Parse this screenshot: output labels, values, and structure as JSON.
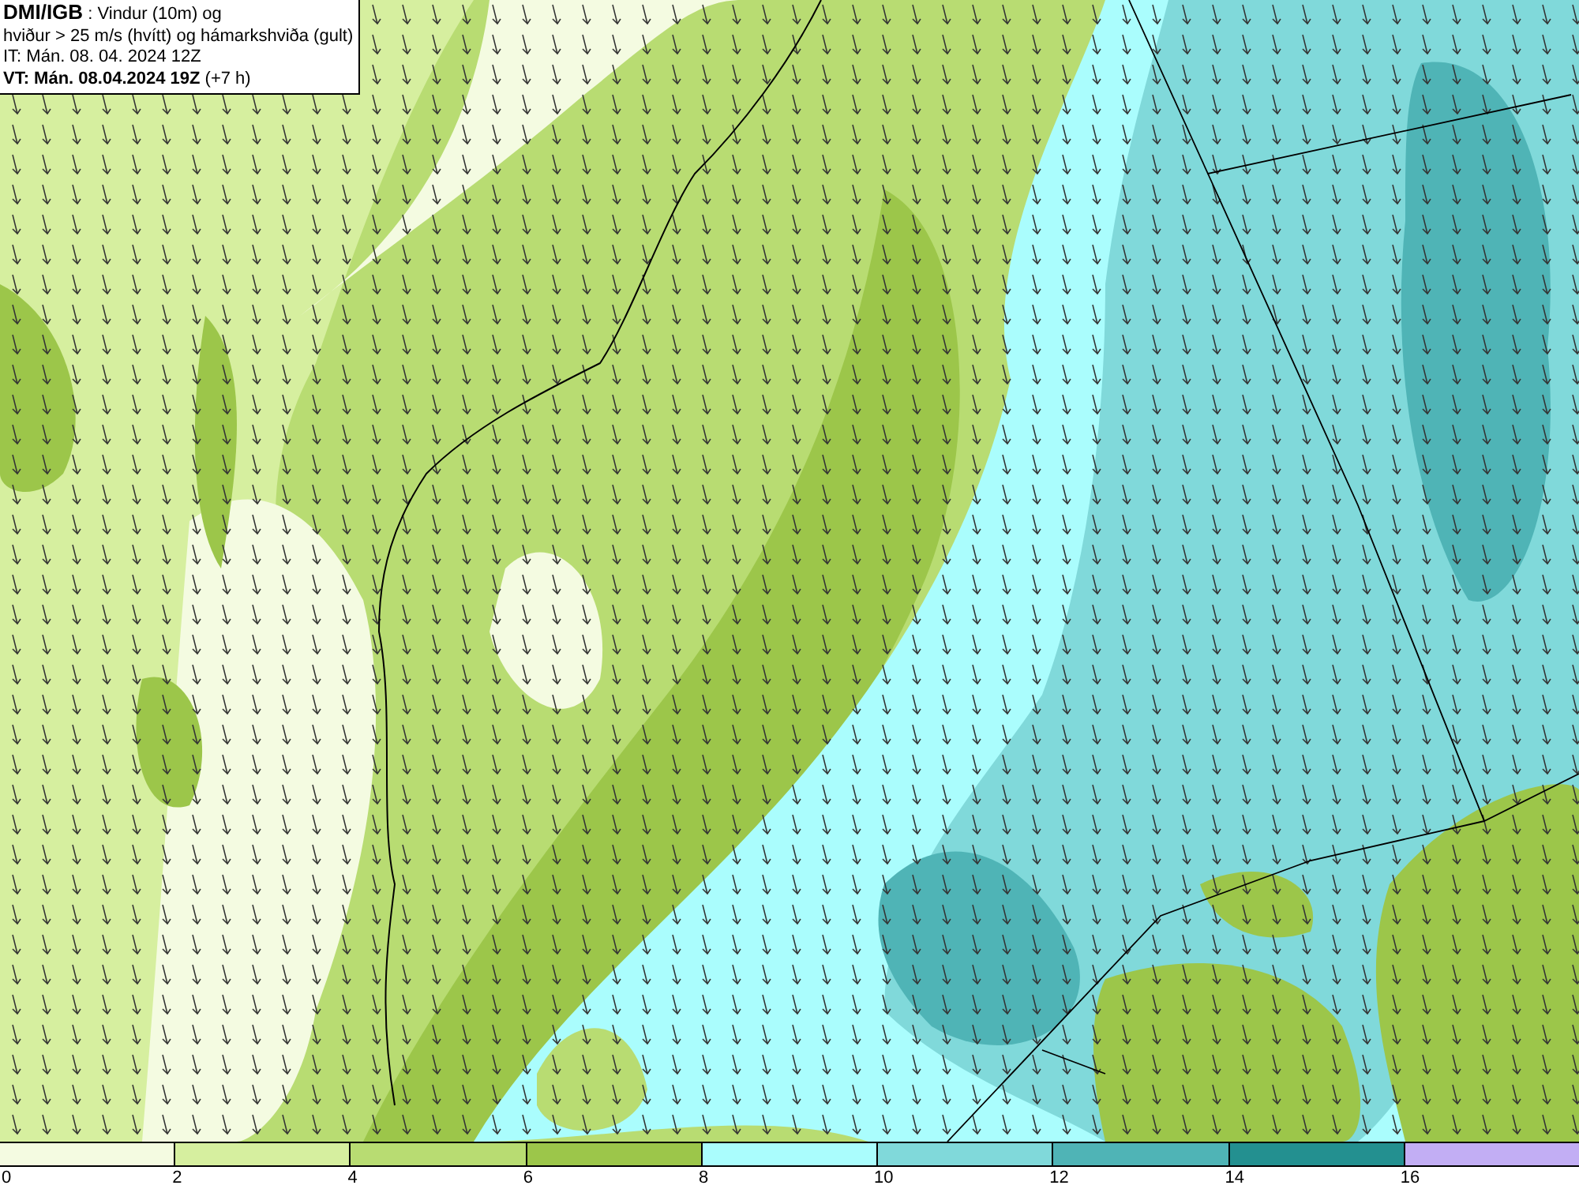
{
  "info_box": {
    "source": "DMI/IGB",
    "title_rest": " : Vindur (10m) og",
    "subtitle": "hviður > 25 m/s (hvítt) og hámarkshviða (gult)",
    "initial_time": "IT: Mán. 08. 04. 2024 12Z",
    "valid_time": "VT: Mán. 08.04.2024 19Z",
    "lead_time": "(+7 h)"
  },
  "legend": {
    "bins": [
      {
        "color": "#f4fbe1"
      },
      {
        "color": "#d6ef9f"
      },
      {
        "color": "#b8dc72"
      },
      {
        "color": "#9cc64a"
      },
      {
        "color": "#aafdfd"
      },
      {
        "color": "#80d9da"
      },
      {
        "color": "#4fb4b6"
      },
      {
        "color": "#239090"
      },
      {
        "color": "#c2aef4"
      }
    ],
    "ticks": [
      "0",
      "2",
      "4",
      "6",
      "8",
      "10",
      "12",
      "14",
      "16"
    ]
  }
}
